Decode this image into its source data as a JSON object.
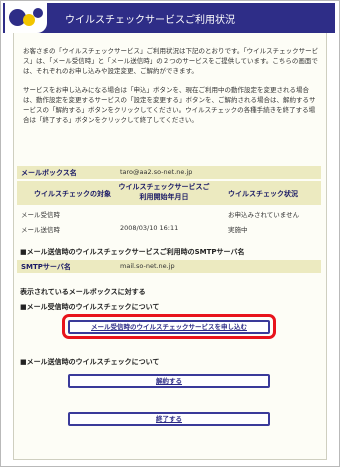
{
  "header": {
    "title": "ウイルスチェックサービスご利用状況"
  },
  "intro": {
    "para1": "お客さまの「ウイルスチェックサービス」ご利用状況は下記のとおりです。「ウイルスチェックサービス」は、「メール受信時」と「メール送信時」の２つのサービスをご提供しています。こちらの画面では、それぞれのお申し込みや設定変更、ご解約ができます。",
    "para2": "サービスをお申し込みになる場合は「申込」ボタンを、現在ご利用中の動作設定を変更される場合は、動作設定を変更するサービスの「設定を変更する」ボタンを、ご解約される場合は、解約するサービスの「解約する」ボタンをクリックしてください。ウイルスチェックの各種手続きを終了する場合は「終了する」ボタンをクリックして終了してください。"
  },
  "mailbox": {
    "label": "メールボックス名",
    "value": "taro@aa2.so-net.ne.jp"
  },
  "status_table": {
    "headers": [
      "ウイルスチェックの対象",
      "ウイルスチェックサービスご利用開始年月日",
      "ウイルスチェック状況"
    ],
    "rows": [
      {
        "target": "メール受信時",
        "date": "",
        "status": "お申込みされていません"
      },
      {
        "target": "メール送信時",
        "date": "2008/03/10 16:11",
        "status": "実施中"
      }
    ]
  },
  "smtp": {
    "section_title": "■メール送信時のウイルスチェックサービスご利用時のSMTPサーバ名",
    "label": "SMTPサーバ名",
    "value": "mail.so-net.ne.jp"
  },
  "actions": {
    "intro": "表示されているメールボックスに対する",
    "receive_title": "■メール受信時のウイルスチェックについて",
    "apply_button": "メール受信時のウイルスチェックサービスを申し込む",
    "send_title": "■メール送信時のウイルスチェックについて",
    "cancel_button": "解約する",
    "finish_button": "終了する"
  }
}
